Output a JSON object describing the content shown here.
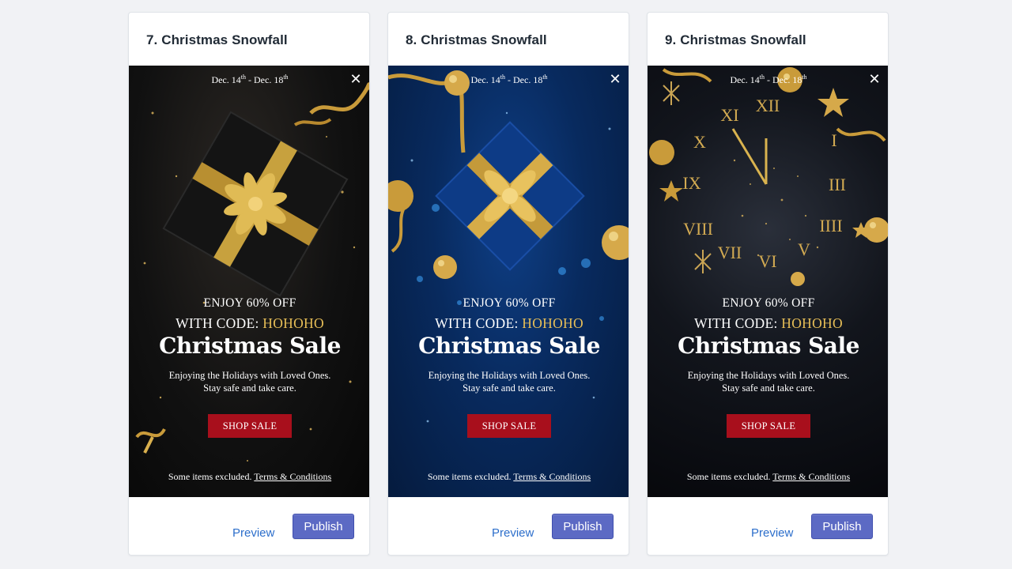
{
  "cards": [
    {
      "title": "7. Christmas Snowfall",
      "popup": {
        "dates_prefix": "Dec. 14",
        "dates_sup1": "th",
        "dates_mid": " - Dec. 18",
        "dates_sup2": "th",
        "close_icon": "close-icon",
        "enjoy": "ENJOY 60% OFF",
        "code_prefix": "WITH CODE: ",
        "code": "HOHOHO",
        "headline": "Christmas Sale",
        "sub1": "Enjoying the Holidays with Loved Ones.",
        "sub2": "Stay safe and take care.",
        "cta": "SHOP SALE",
        "footer_text": "Some items excluded. ",
        "terms": "Terms & Conditions"
      },
      "preview_label": "Preview",
      "publish_label": "Publish"
    },
    {
      "title": "8. Christmas Snowfall",
      "popup": {
        "dates_prefix": "Dec. 14",
        "dates_sup1": "th",
        "dates_mid": " - Dec. 18",
        "dates_sup2": "th",
        "close_icon": "close-icon",
        "enjoy": "ENJOY 60% OFF",
        "code_prefix": "WITH CODE: ",
        "code": "HOHOHO",
        "headline": "Christmas Sale",
        "sub1": "Enjoying the Holidays with Loved Ones.",
        "sub2": "Stay safe and take care.",
        "cta": "SHOP SALE",
        "footer_text": "Some items excluded. ",
        "terms": "Terms & Conditions"
      },
      "preview_label": "Preview",
      "publish_label": "Publish"
    },
    {
      "title": "9. Christmas Snowfall",
      "popup": {
        "dates_prefix": "Dec. 14",
        "dates_sup1": "th",
        "dates_mid": " - Dec. 18",
        "dates_sup2": "th",
        "close_icon": "close-icon",
        "enjoy": "ENJOY 60% OFF",
        "code_prefix": "WITH CODE: ",
        "code": "HOHOHO",
        "headline": "Christmas Sale",
        "sub1": "Enjoying the Holidays with Loved Ones.",
        "sub2": "Stay safe and take care.",
        "cta": "SHOP SALE",
        "footer_text": "Some items excluded. ",
        "terms": "Terms & Conditions"
      },
      "preview_label": "Preview",
      "publish_label": "Publish"
    }
  ],
  "colors": {
    "page_bg": "#f1f2f5",
    "gold_accent": "#e8bf57",
    "cta_red": "#a80f1c",
    "publish_purple": "#5c6ac4",
    "link_blue": "#2c6ecb"
  }
}
